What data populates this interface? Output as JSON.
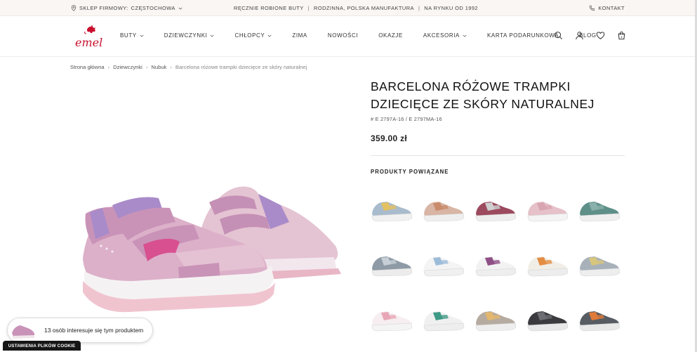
{
  "topbar": {
    "store_label": "SKLEP FIRMOWY:",
    "store_city": "CZĘSTOCHOWA",
    "promo": [
      "RĘCZNIE ROBIONE BUTY",
      "RODZINNA, POLSKA MANUFAKTURA",
      "NA RYNKU OD 1992"
    ],
    "promo_separator": "|",
    "contact_label": "KONTAKT"
  },
  "header": {
    "logo_text": "emel",
    "nav": [
      {
        "label": "BUTY",
        "dropdown": true
      },
      {
        "label": "DZIEWCZYNKI",
        "dropdown": true
      },
      {
        "label": "CHŁOPCY",
        "dropdown": true
      },
      {
        "label": "ZIMA",
        "dropdown": false
      },
      {
        "label": "NOWOŚCI",
        "dropdown": false
      },
      {
        "label": "OKAZJE",
        "dropdown": false
      },
      {
        "label": "AKCESORIA",
        "dropdown": true
      },
      {
        "label": "KARTA PODARUNKOWA",
        "dropdown": false
      },
      {
        "label": "BLOG",
        "dropdown": false
      }
    ],
    "icons": [
      "search-icon",
      "account-icon",
      "wishlist-heart-icon",
      "cart-bag-icon"
    ]
  },
  "breadcrumb": {
    "items": [
      "Strona główna",
      "Dziewczynki",
      "Nubuk",
      "Barcelona różowe trampki dziecięce ze skóry naturalnej"
    ],
    "separator": "›"
  },
  "product": {
    "title_line1": "BARCELONA RÓŻOWE TRAMPKI",
    "title_line2": "DZIECIĘCE ZE SKÓRY NATURALNEJ",
    "sku": "# E 2797A-16 / E 2797MA-16",
    "price": "359.00 zł"
  },
  "related": {
    "title": "PRODUKTY POWIĄZANE",
    "items": [
      {
        "upper": "#a9bccd",
        "accent": "#e3c160",
        "sole": "#f1f1f1"
      },
      {
        "upper": "#d8b5a4",
        "accent": "#c98b6c",
        "sole": "#efefef"
      },
      {
        "upper": "#9c4a5e",
        "accent": "#cfcfcf",
        "sole": "#eeeeee"
      },
      {
        "upper": "#e6c1c9",
        "accent": "#d9a5b2",
        "sole": "#f4f4f4"
      },
      {
        "upper": "#5f8f89",
        "accent": "#8ab0ab",
        "sole": "#efefef"
      },
      {
        "upper": "#8e9aa6",
        "accent": "#c7cfd6",
        "sole": "#ececec"
      },
      {
        "upper": "#f4f4f4",
        "accent": "#9dbcd9",
        "sole": "#f0f0f0"
      },
      {
        "upper": "#f2f2f2",
        "accent": "#8e4f86",
        "sole": "#eeeeee"
      },
      {
        "upper": "#f1eee7",
        "accent": "#e38d44",
        "sole": "#ededed"
      },
      {
        "upper": "#a8b1ba",
        "accent": "#d7c67d",
        "sole": "#eeeeee"
      },
      {
        "upper": "#f6eef0",
        "accent": "#e7a7b6",
        "sole": "#f4f4f4"
      },
      {
        "upper": "#f0f0f0",
        "accent": "#3f9a86",
        "sole": "#eeeeee"
      },
      {
        "upper": "#b6aba0",
        "accent": "#e3b76e",
        "sole": "#eeeeee"
      },
      {
        "upper": "#3b3b3f",
        "accent": "#6d6d74",
        "sole": "#e8e8e8"
      },
      {
        "upper": "#575c63",
        "accent": "#e07a3a",
        "sole": "#e8e8e8"
      }
    ]
  },
  "social_proof": {
    "text": "13 osób interesuje się tym produktem"
  },
  "cookie": {
    "label": "USTAWIENIA PLIKÓW COOKIE"
  },
  "colors": {
    "brand": "#c8102e",
    "topbar_bg": "#faf6f3",
    "shoe_pink": "#c993b8",
    "shoe_lilac": "#a98bc9"
  }
}
